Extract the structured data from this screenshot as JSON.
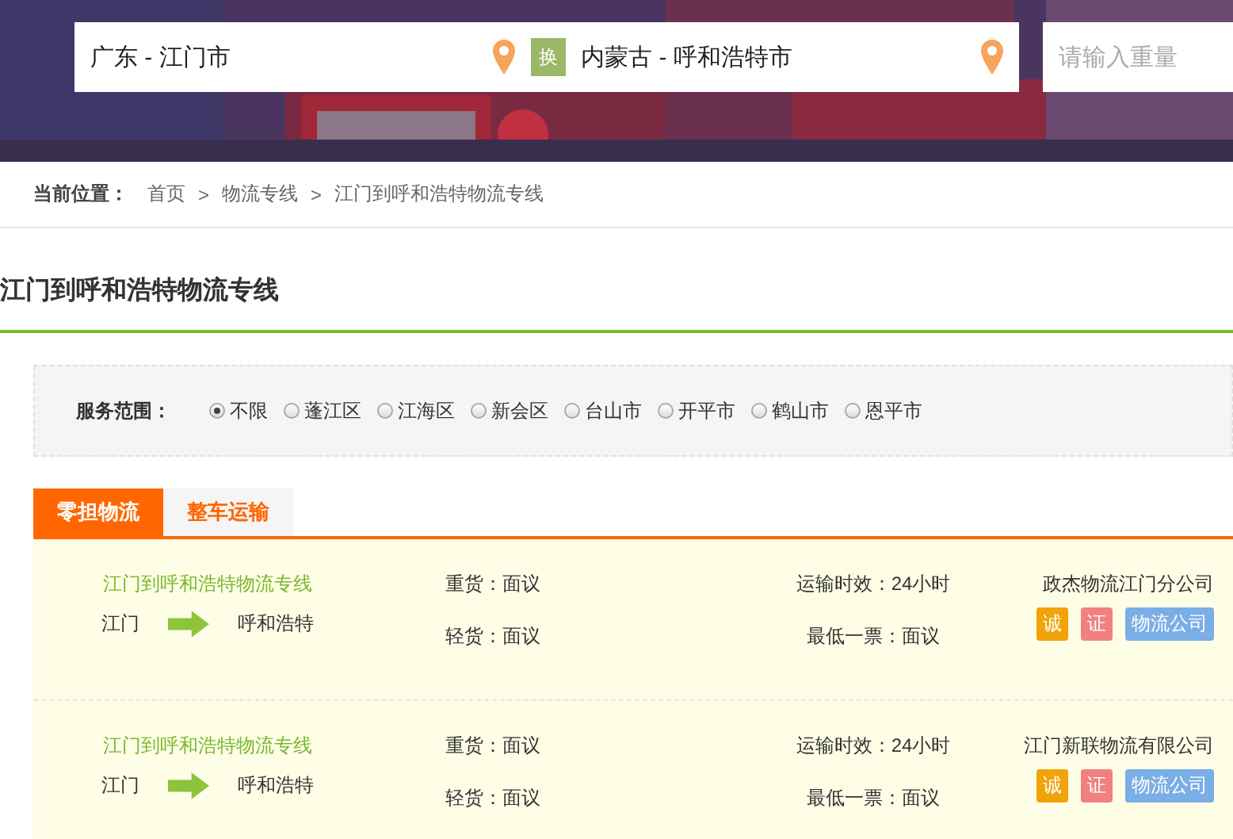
{
  "search": {
    "origin": "广东 - 江门市",
    "swap": "换",
    "destination": "内蒙古 - 呼和浩特市",
    "weight_placeholder": "请输入重量"
  },
  "breadcrumb": {
    "label": "当前位置：",
    "items": [
      "首页",
      "物流专线",
      "江门到呼和浩特物流专线"
    ],
    "separator": ">"
  },
  "page_title": "江门到呼和浩特物流专线",
  "filter": {
    "label": "服务范围：",
    "options": [
      {
        "label": "不限",
        "selected": true
      },
      {
        "label": "蓬江区",
        "selected": false
      },
      {
        "label": "江海区",
        "selected": false
      },
      {
        "label": "新会区",
        "selected": false
      },
      {
        "label": "台山市",
        "selected": false
      },
      {
        "label": "开平市",
        "selected": false
      },
      {
        "label": "鹤山市",
        "selected": false
      },
      {
        "label": "恩平市",
        "selected": false
      }
    ]
  },
  "tabs": [
    {
      "label": "零担物流",
      "selected": true
    },
    {
      "label": "整车运输",
      "selected": false
    }
  ],
  "routes": [
    {
      "title": "江门到呼和浩特物流专线",
      "from": "江门",
      "to": "呼和浩特",
      "heavy": "重货：面议",
      "light": "轻货：面议",
      "transit": "运输时效：24小时",
      "minimum": "最低一票：面议",
      "company": "政杰物流江门分公司",
      "badges": [
        {
          "label": "诚",
          "color": "#f0a30a"
        },
        {
          "label": "证",
          "color": "#f28080"
        },
        {
          "label": "物流公司",
          "color": "#7aaee6"
        }
      ]
    },
    {
      "title": "江门到呼和浩特物流专线",
      "from": "江门",
      "to": "呼和浩特",
      "heavy": "重货：面议",
      "light": "轻货：面议",
      "transit": "运输时效：24小时",
      "minimum": "最低一票：面议",
      "company": "江门新联物流有限公司",
      "badges": [
        {
          "label": "诚",
          "color": "#f0a30a"
        },
        {
          "label": "证",
          "color": "#f28080"
        },
        {
          "label": "物流公司",
          "color": "#7aaee6"
        }
      ]
    }
  ]
}
